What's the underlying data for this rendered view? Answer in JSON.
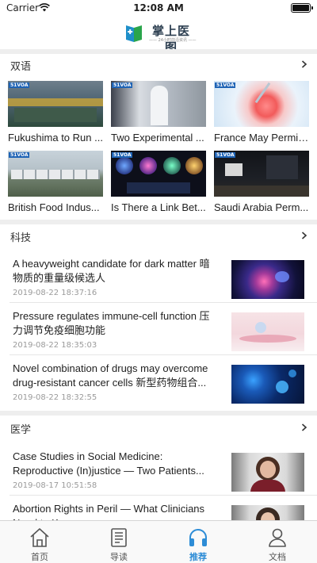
{
  "status_bar": {
    "carrier": "Carrier",
    "time": "12:08 AM"
  },
  "header": {
    "app_name": "掌上医图",
    "slogan": "—— 24小时前沿资讯 ——"
  },
  "sections": {
    "bilingual": {
      "title": "双语",
      "items": [
        {
          "caption": "Fukushima to Run ..."
        },
        {
          "caption": "Two Experimental ..."
        },
        {
          "caption": "France May Permit..."
        },
        {
          "caption": "British Food Indus..."
        },
        {
          "caption": "Is There a Link Bet..."
        },
        {
          "caption": "Saudi Arabia Perm..."
        }
      ]
    },
    "technology": {
      "title": "科技",
      "articles": [
        {
          "headline": "A heavyweight candidate for dark matter 暗物质的重量级候选人",
          "date": "2019-08-22 18:37:16"
        },
        {
          "headline": "Pressure regulates immune-cell function 压力调节免疫细胞功能",
          "date": "2019-08-22 18:35:03"
        },
        {
          "headline": "Novel combination of drugs may overcome drug-resistant cancer cells 新型药物组合...",
          "date": "2019-08-22 18:32:55"
        }
      ]
    },
    "medicine": {
      "title": "医学",
      "articles": [
        {
          "headline": "Case Studies in Social Medicine: Reproductive (In)justice — Two Patients...",
          "date": "2019-08-17 10:51:58"
        },
        {
          "headline": "Abortion Rights in Peril — What Clinicians Need to Know",
          "date": ""
        }
      ]
    }
  },
  "tab_bar": {
    "tabs": [
      {
        "label": "首页",
        "icon": "home-icon"
      },
      {
        "label": "导读",
        "icon": "reading-guide-icon"
      },
      {
        "label": "推荐",
        "icon": "headphones-icon"
      },
      {
        "label": "文档",
        "icon": "person-icon"
      }
    ],
    "active_color": "#2d8cd6"
  }
}
